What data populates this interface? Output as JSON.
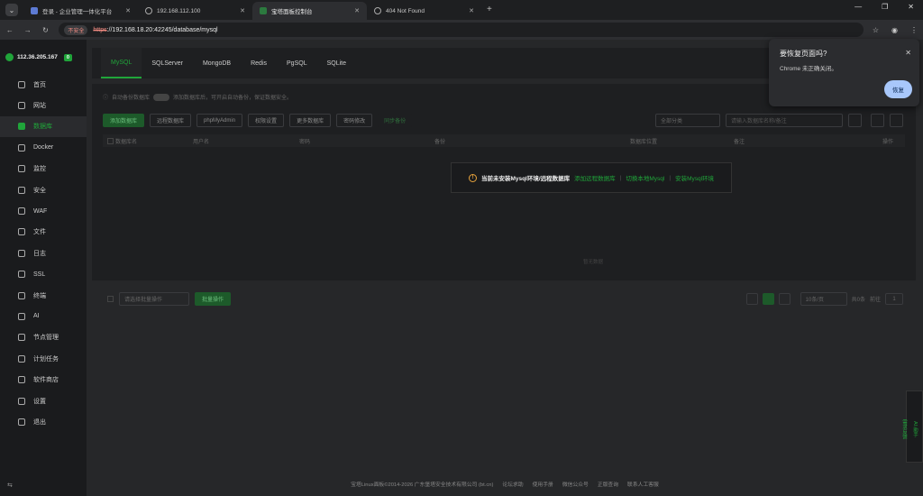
{
  "browser": {
    "tabs": [
      {
        "label": "登录 - 企业管理一体化平台",
        "icon": "page-icon"
      },
      {
        "label": "192.168.112.100",
        "icon": "globe-icon"
      },
      {
        "label": "宝塔面板控制台",
        "icon": "bt-icon",
        "active": true
      },
      {
        "label": "404 Not Found",
        "icon": "globe-icon"
      }
    ],
    "security_label": "不安全",
    "url_scheme": "https",
    "url_rest": "://192.168.18.20:42245/database/mysql"
  },
  "sidebar": {
    "server_ip": "112.36.205.167",
    "badge": "0",
    "items": [
      {
        "label": "首页"
      },
      {
        "label": "网站"
      },
      {
        "label": "数据库",
        "active": true
      },
      {
        "label": "Docker"
      },
      {
        "label": "监控"
      },
      {
        "label": "安全"
      },
      {
        "label": "WAF"
      },
      {
        "label": "文件"
      },
      {
        "label": "日志"
      },
      {
        "label": "SSL"
      },
      {
        "label": "终端"
      },
      {
        "label": "AI"
      },
      {
        "label": "节点管理"
      },
      {
        "label": "计划任务"
      },
      {
        "label": "软件商店"
      },
      {
        "label": "设置"
      },
      {
        "label": "退出"
      }
    ]
  },
  "db_tabs": [
    "MySQL",
    "SQLServer",
    "MongoDB",
    "Redis",
    "PgSQL",
    "SQLite"
  ],
  "notice": {
    "label": "自动备份数据库",
    "desc": "添加数据库后，可开启自动备份，保证数据安全。"
  },
  "toolbar": {
    "buttons": [
      "添加数据库",
      "远程数据库",
      "phpMyAdmin",
      "权限设置",
      "更多数据库",
      "密码修改",
      "同步备份"
    ],
    "category_placeholder": "全部分类",
    "search_placeholder": "请输入数据库名称/备注"
  },
  "table": {
    "headers": [
      "数据库名",
      "用户名",
      "密码",
      "备份",
      "数据库位置",
      "备注",
      "操作"
    ],
    "empty_text": "暂无数据"
  },
  "overlay": {
    "message": "当前未安装Mysql环境/远程数据库",
    "link1": "添加远程数据库",
    "link2": "切换本地Mysql",
    "link3": "安装Mysql环境"
  },
  "batch": {
    "select_placeholder": "请选择批量操作",
    "exec_label": "批量操作"
  },
  "pagination": {
    "page_size": "10条/页",
    "total": "共0条",
    "goto_label": "前往",
    "page": "1"
  },
  "footer": {
    "copyright": "宝塔Linux面板©2014-2026 广东堡塔安全技术有限公司 (bt.cn)",
    "links": [
      "论坛求助",
      "使用手册",
      "微信公众号",
      "正版查询",
      "联系人工客服"
    ]
  },
  "restore_popup": {
    "title": "要恢复页面吗?",
    "body": "Chrome 未正确关闭。",
    "button": "恢复"
  },
  "float_widget": {
    "label1": "AI 助手",
    "label2": "需求反馈"
  }
}
